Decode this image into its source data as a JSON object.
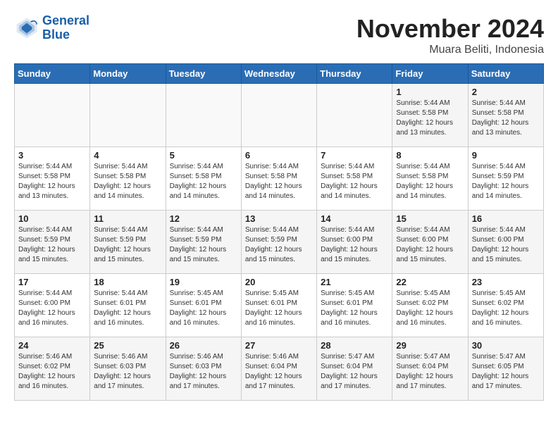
{
  "header": {
    "logo_line1": "General",
    "logo_line2": "Blue",
    "month": "November 2024",
    "location": "Muara Beliti, Indonesia"
  },
  "weekdays": [
    "Sunday",
    "Monday",
    "Tuesday",
    "Wednesday",
    "Thursday",
    "Friday",
    "Saturday"
  ],
  "weeks": [
    [
      {
        "day": "",
        "info": ""
      },
      {
        "day": "",
        "info": ""
      },
      {
        "day": "",
        "info": ""
      },
      {
        "day": "",
        "info": ""
      },
      {
        "day": "",
        "info": ""
      },
      {
        "day": "1",
        "info": "Sunrise: 5:44 AM\nSunset: 5:58 PM\nDaylight: 12 hours\nand 13 minutes."
      },
      {
        "day": "2",
        "info": "Sunrise: 5:44 AM\nSunset: 5:58 PM\nDaylight: 12 hours\nand 13 minutes."
      }
    ],
    [
      {
        "day": "3",
        "info": "Sunrise: 5:44 AM\nSunset: 5:58 PM\nDaylight: 12 hours\nand 13 minutes."
      },
      {
        "day": "4",
        "info": "Sunrise: 5:44 AM\nSunset: 5:58 PM\nDaylight: 12 hours\nand 14 minutes."
      },
      {
        "day": "5",
        "info": "Sunrise: 5:44 AM\nSunset: 5:58 PM\nDaylight: 12 hours\nand 14 minutes."
      },
      {
        "day": "6",
        "info": "Sunrise: 5:44 AM\nSunset: 5:58 PM\nDaylight: 12 hours\nand 14 minutes."
      },
      {
        "day": "7",
        "info": "Sunrise: 5:44 AM\nSunset: 5:58 PM\nDaylight: 12 hours\nand 14 minutes."
      },
      {
        "day": "8",
        "info": "Sunrise: 5:44 AM\nSunset: 5:58 PM\nDaylight: 12 hours\nand 14 minutes."
      },
      {
        "day": "9",
        "info": "Sunrise: 5:44 AM\nSunset: 5:59 PM\nDaylight: 12 hours\nand 14 minutes."
      }
    ],
    [
      {
        "day": "10",
        "info": "Sunrise: 5:44 AM\nSunset: 5:59 PM\nDaylight: 12 hours\nand 15 minutes."
      },
      {
        "day": "11",
        "info": "Sunrise: 5:44 AM\nSunset: 5:59 PM\nDaylight: 12 hours\nand 15 minutes."
      },
      {
        "day": "12",
        "info": "Sunrise: 5:44 AM\nSunset: 5:59 PM\nDaylight: 12 hours\nand 15 minutes."
      },
      {
        "day": "13",
        "info": "Sunrise: 5:44 AM\nSunset: 5:59 PM\nDaylight: 12 hours\nand 15 minutes."
      },
      {
        "day": "14",
        "info": "Sunrise: 5:44 AM\nSunset: 6:00 PM\nDaylight: 12 hours\nand 15 minutes."
      },
      {
        "day": "15",
        "info": "Sunrise: 5:44 AM\nSunset: 6:00 PM\nDaylight: 12 hours\nand 15 minutes."
      },
      {
        "day": "16",
        "info": "Sunrise: 5:44 AM\nSunset: 6:00 PM\nDaylight: 12 hours\nand 15 minutes."
      }
    ],
    [
      {
        "day": "17",
        "info": "Sunrise: 5:44 AM\nSunset: 6:00 PM\nDaylight: 12 hours\nand 16 minutes."
      },
      {
        "day": "18",
        "info": "Sunrise: 5:44 AM\nSunset: 6:01 PM\nDaylight: 12 hours\nand 16 minutes."
      },
      {
        "day": "19",
        "info": "Sunrise: 5:45 AM\nSunset: 6:01 PM\nDaylight: 12 hours\nand 16 minutes."
      },
      {
        "day": "20",
        "info": "Sunrise: 5:45 AM\nSunset: 6:01 PM\nDaylight: 12 hours\nand 16 minutes."
      },
      {
        "day": "21",
        "info": "Sunrise: 5:45 AM\nSunset: 6:01 PM\nDaylight: 12 hours\nand 16 minutes."
      },
      {
        "day": "22",
        "info": "Sunrise: 5:45 AM\nSunset: 6:02 PM\nDaylight: 12 hours\nand 16 minutes."
      },
      {
        "day": "23",
        "info": "Sunrise: 5:45 AM\nSunset: 6:02 PM\nDaylight: 12 hours\nand 16 minutes."
      }
    ],
    [
      {
        "day": "24",
        "info": "Sunrise: 5:46 AM\nSunset: 6:02 PM\nDaylight: 12 hours\nand 16 minutes."
      },
      {
        "day": "25",
        "info": "Sunrise: 5:46 AM\nSunset: 6:03 PM\nDaylight: 12 hours\nand 17 minutes."
      },
      {
        "day": "26",
        "info": "Sunrise: 5:46 AM\nSunset: 6:03 PM\nDaylight: 12 hours\nand 17 minutes."
      },
      {
        "day": "27",
        "info": "Sunrise: 5:46 AM\nSunset: 6:04 PM\nDaylight: 12 hours\nand 17 minutes."
      },
      {
        "day": "28",
        "info": "Sunrise: 5:47 AM\nSunset: 6:04 PM\nDaylight: 12 hours\nand 17 minutes."
      },
      {
        "day": "29",
        "info": "Sunrise: 5:47 AM\nSunset: 6:04 PM\nDaylight: 12 hours\nand 17 minutes."
      },
      {
        "day": "30",
        "info": "Sunrise: 5:47 AM\nSunset: 6:05 PM\nDaylight: 12 hours\nand 17 minutes."
      }
    ]
  ]
}
